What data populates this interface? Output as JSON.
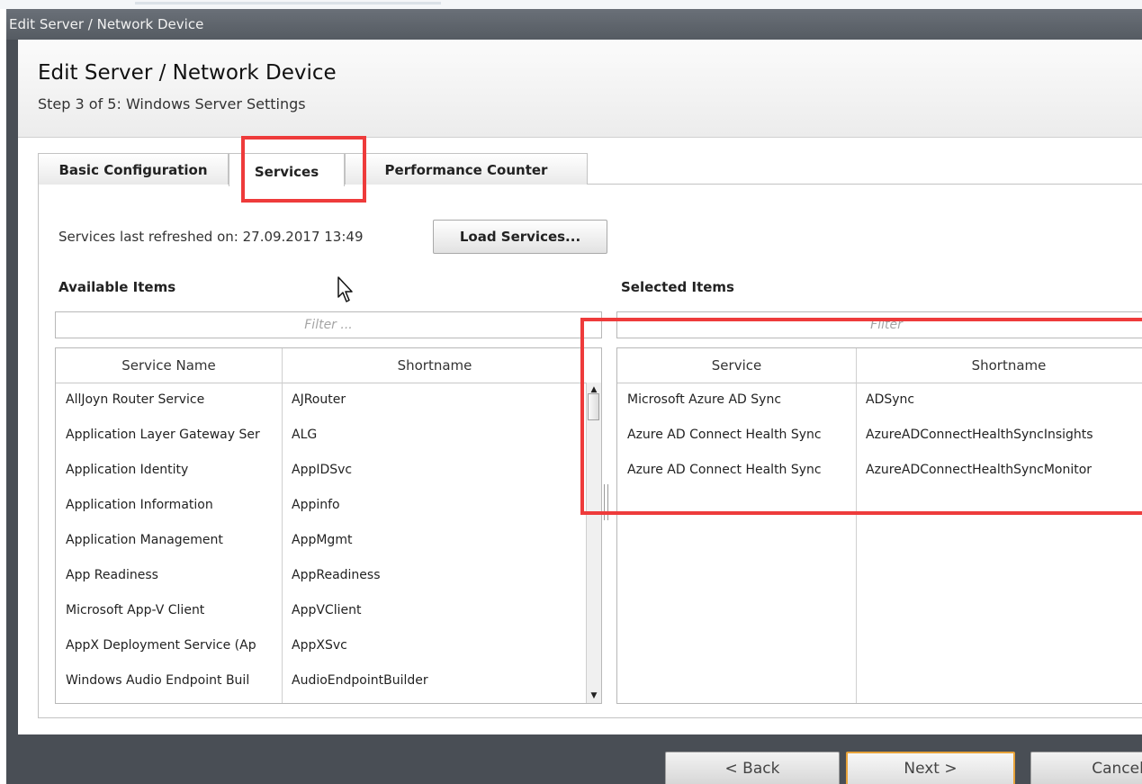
{
  "window": {
    "title": "Edit Server / Network Device"
  },
  "header": {
    "title": "Edit Server / Network Device",
    "subtitle": "Step 3 of 5: Windows Server Settings"
  },
  "tabs": [
    {
      "label": "Basic Configuration",
      "active": false
    },
    {
      "label": "Services",
      "active": true
    },
    {
      "label": "Performance Counter",
      "active": false
    }
  ],
  "services": {
    "refresh_text": "Services last refreshed on: 27.09.2017 13:49",
    "load_button": "Load Services..."
  },
  "available": {
    "label": "Available Items",
    "filter_placeholder": "Filter ...",
    "columns": [
      "Service Name",
      "Shortname"
    ],
    "rows": [
      [
        "AllJoyn Router Service",
        "AJRouter"
      ],
      [
        "Application Layer Gateway Ser",
        "ALG"
      ],
      [
        "Application Identity",
        "AppIDSvc"
      ],
      [
        "Application Information",
        "Appinfo"
      ],
      [
        "Application Management",
        "AppMgmt"
      ],
      [
        "App Readiness",
        "AppReadiness"
      ],
      [
        "Microsoft App-V Client",
        "AppVClient"
      ],
      [
        "AppX Deployment Service (Ap",
        "AppXSvc"
      ],
      [
        "Windows Audio Endpoint Buil",
        "AudioEndpointBuilder"
      ]
    ]
  },
  "selected": {
    "label": "Selected Items",
    "filter_placeholder": "Filter",
    "columns": [
      "Service",
      "Shortname"
    ],
    "rows": [
      [
        "Microsoft Azure AD Sync",
        "ADSync"
      ],
      [
        "Azure AD Connect Health Sync",
        "AzureADConnectHealthSyncInsights"
      ],
      [
        "Azure AD Connect Health Sync",
        "AzureADConnectHealthSyncMonitor"
      ]
    ]
  },
  "footer": {
    "back": "< Back",
    "next": "Next >",
    "cancel": "Cancel"
  },
  "colors": {
    "highlight": "#ee3b3b",
    "next_border": "#e8a33a",
    "window_bg": "#494e55"
  }
}
